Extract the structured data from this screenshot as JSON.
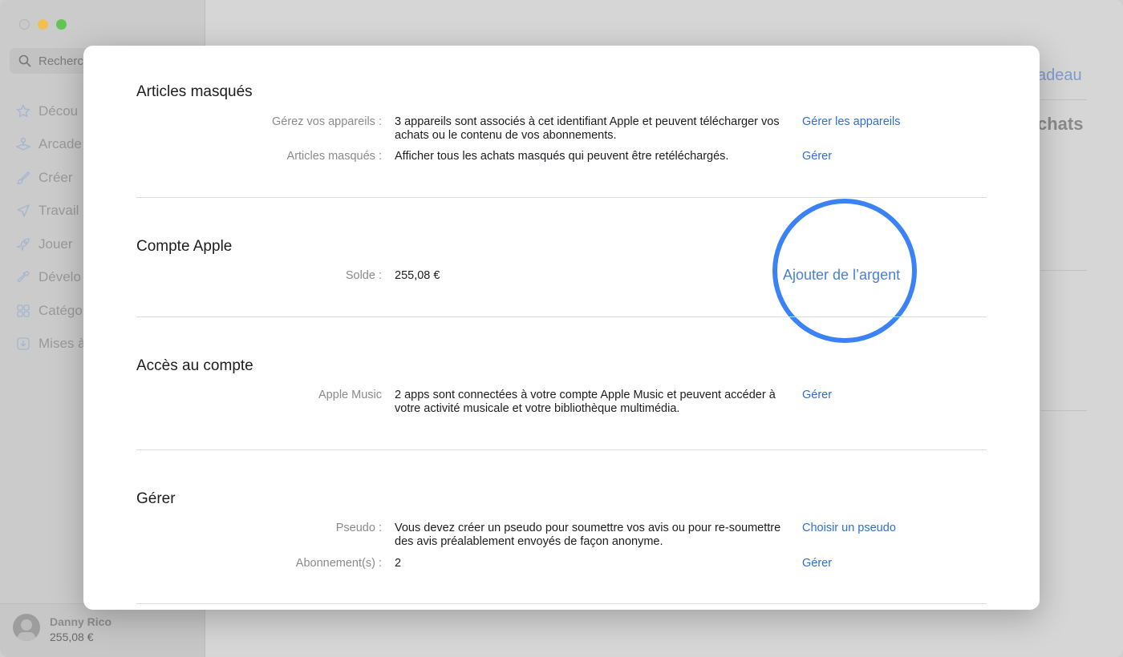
{
  "sidebar": {
    "search_placeholder": "Recherc",
    "items": [
      {
        "label": "Décou",
        "icon": "star-icon"
      },
      {
        "label": "Arcade",
        "icon": "joystick-icon"
      },
      {
        "label": "Créer",
        "icon": "brush-icon"
      },
      {
        "label": "Travail",
        "icon": "paper-plane-icon"
      },
      {
        "label": "Jouer",
        "icon": "rocket-icon"
      },
      {
        "label": "Dévelo",
        "icon": "hammer-icon"
      },
      {
        "label": "Catégo",
        "icon": "grid-icon"
      },
      {
        "label": "Mises à",
        "icon": "download-icon"
      }
    ],
    "account": {
      "name": "Danny Rico",
      "balance": "255,08 €"
    }
  },
  "background": {
    "link_partial": "adeau",
    "title_partial": "chats"
  },
  "modal": {
    "hidden_items": {
      "title": "Articles masqués",
      "rows": [
        {
          "label": "Gérez vos appareils :",
          "value": "3 appareils sont associés à cet identifiant Apple et peuvent télécharger vos achats ou le contenu de vos abonnements.",
          "link": "Gérer les appareils"
        },
        {
          "label": "Articles masqués :",
          "value": "Afficher tous les achats masqués qui peuvent être retéléchargés.",
          "link": "Gérer"
        }
      ]
    },
    "apple_account": {
      "title": "Compte Apple",
      "label": "Solde :",
      "value": "255,08 €",
      "link": "Ajouter de l’argent"
    },
    "account_access": {
      "title": "Accès au compte",
      "label": "Apple Music",
      "value": "2 apps sont connectées à votre compte Apple Music et peuvent accéder à votre activité musicale et votre bibliothèque multimédia.",
      "link": "Gérer"
    },
    "manage": {
      "title": "Gérer",
      "rows": [
        {
          "label": "Pseudo :",
          "value": "Vous devez créer un pseudo pour soumettre vos avis ou pour re-soumettre des avis préalablement envoyés de façon anonyme.",
          "link": "Choisir un pseudo"
        },
        {
          "label": "Abonnement(s) :",
          "value": "2",
          "link": "Gérer"
        }
      ]
    }
  },
  "colors": {
    "link": "#2f6fd1",
    "highlight": "#3b82f6"
  }
}
